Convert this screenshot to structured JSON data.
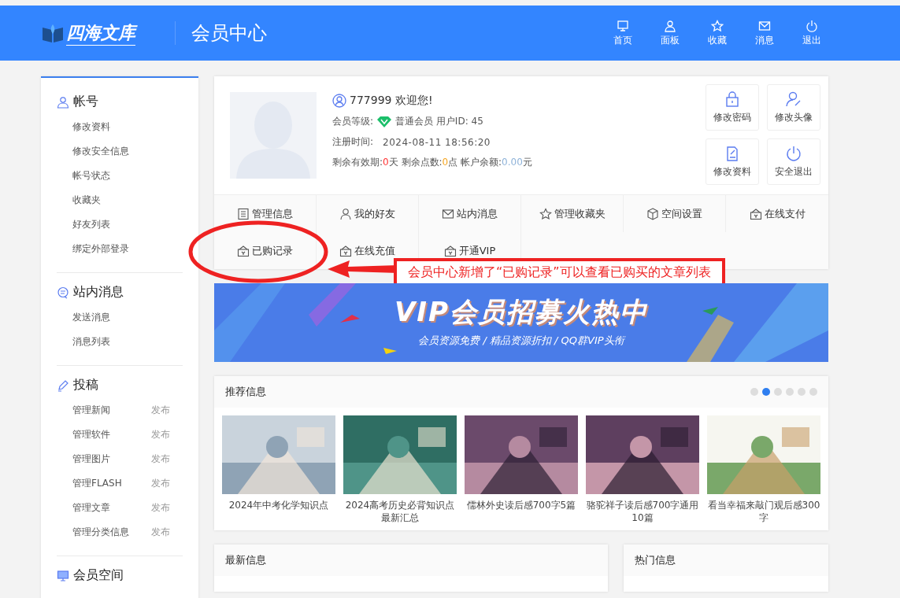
{
  "header": {
    "logo": "四海文库",
    "title": "会员中心",
    "nav": [
      {
        "label": "首页",
        "kind": "monitor"
      },
      {
        "label": "面板",
        "kind": "user"
      },
      {
        "label": "收藏",
        "kind": "star"
      },
      {
        "label": "消息",
        "kind": "mail"
      },
      {
        "label": "退出",
        "kind": "power"
      }
    ]
  },
  "sidebar": {
    "sections": [
      {
        "title": "帐号",
        "kind": "user",
        "items": [
          {
            "label": "修改资料"
          },
          {
            "label": "修改安全信息"
          },
          {
            "label": "帐号状态"
          },
          {
            "label": "收藏夹"
          },
          {
            "label": "好友列表"
          },
          {
            "label": "绑定外部登录"
          }
        ]
      },
      {
        "title": "站内消息",
        "kind": "chat",
        "items": [
          {
            "label": "发送消息"
          },
          {
            "label": "消息列表"
          }
        ]
      },
      {
        "title": "投稿",
        "kind": "pen",
        "items": [
          {
            "label": "管理新闻",
            "action": "发布"
          },
          {
            "label": "管理软件",
            "action": "发布"
          },
          {
            "label": "管理图片",
            "action": "发布"
          },
          {
            "label": "管理FLASH",
            "action": "发布"
          },
          {
            "label": "管理文章",
            "action": "发布"
          },
          {
            "label": "管理分类信息",
            "action": "发布"
          }
        ]
      },
      {
        "title": "会员空间",
        "kind": "monitor"
      }
    ]
  },
  "profile": {
    "username": "777999",
    "welcome": "欢迎您!",
    "level_label": "会员等级:",
    "level": "普通会员",
    "user_id": "用户ID: 45",
    "register_label": "注册时间:",
    "register_time": "2024-08-11 18:56:20",
    "days_label": "剩余有效期:",
    "days": "0",
    "days_unit": "天",
    "points_label": "剩余点数:",
    "points": "0",
    "points_unit": "点",
    "balance_label": "帐户余额:",
    "balance": "0.00",
    "balance_unit": "元",
    "actions": [
      {
        "label": "修改密码",
        "kind": "lock"
      },
      {
        "label": "修改头像",
        "kind": "user-edit"
      },
      {
        "label": "修改资料",
        "kind": "doc-edit"
      },
      {
        "label": "安全退出",
        "kind": "power"
      }
    ]
  },
  "menu": [
    {
      "label": "管理信息",
      "kind": "list"
    },
    {
      "label": "我的好友",
      "kind": "user"
    },
    {
      "label": "站内消息",
      "kind": "mail"
    },
    {
      "label": "管理收藏夹",
      "kind": "star"
    },
    {
      "label": "空间设置",
      "kind": "cube"
    },
    {
      "label": "在线支付",
      "kind": "bag"
    },
    {
      "label": "已购记录",
      "kind": "bag"
    },
    {
      "label": "在线充值",
      "kind": "bag"
    },
    {
      "label": "开通VIP",
      "kind": "bag"
    }
  ],
  "annotation": {
    "text": "会员中心新增了“已购记录”可以查看已购买的文章列表"
  },
  "banner": {
    "title": "VIP会员招募火热中",
    "subtitle": "会员资源免费 / 精品资源折扣 / QQ群VIP头衔"
  },
  "recommend": {
    "title": "推荐信息",
    "dots": [
      {
        "selected": false
      },
      {
        "selected": true
      },
      {
        "selected": false
      },
      {
        "selected": false
      },
      {
        "selected": false
      },
      {
        "selected": false
      }
    ],
    "items": [
      {
        "title": "2024年中考化学知识点",
        "kind": "picture"
      },
      {
        "title": "2024高考历史必背知识点最新汇总",
        "kind": "picture"
      },
      {
        "title": "儒林外史读后感700字5篇",
        "kind": "picture"
      },
      {
        "title": "骆驼祥子读后感700字通用10篇",
        "kind": "picture"
      },
      {
        "title": "看当幸福来敲门观后感300字",
        "kind": "picture"
      }
    ]
  },
  "latest": {
    "title": "最新信息"
  },
  "hot": {
    "title": "热门信息"
  }
}
